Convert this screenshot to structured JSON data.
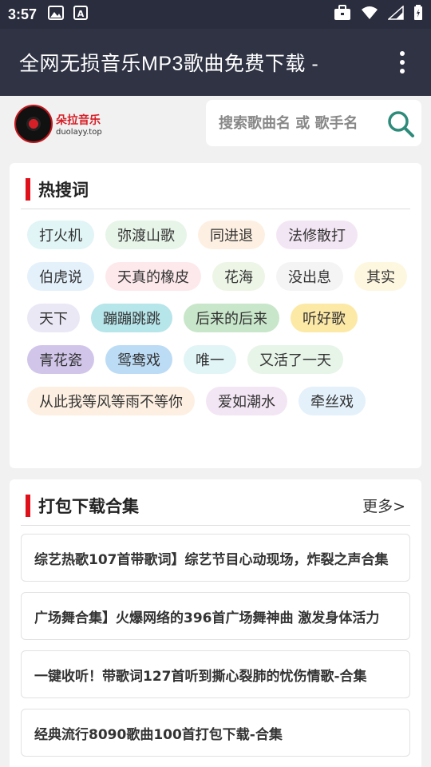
{
  "status": {
    "time": "3:57"
  },
  "app": {
    "title": "全网无损音乐MP3歌曲免费下载 -"
  },
  "logo": {
    "cn": "朵拉音乐",
    "en": "duolayy.top"
  },
  "search": {
    "placeholder": "搜索歌曲名 或 歌手名"
  },
  "hot": {
    "title": "热搜词",
    "tags": [
      {
        "label": "打火机",
        "color": "#e1f4f6"
      },
      {
        "label": "弥渡山歌",
        "color": "#e7f4e8"
      },
      {
        "label": "同进退",
        "color": "#fdf0e2"
      },
      {
        "label": "法修散打",
        "color": "#f3e6f4"
      },
      {
        "label": "伯虎说",
        "color": "#e4f1fb"
      },
      {
        "label": "天真的橡皮",
        "color": "#fde9ec"
      },
      {
        "label": "花海",
        "color": "#edf5e6"
      },
      {
        "label": "没出息",
        "color": "#f4f4f4"
      },
      {
        "label": "其实",
        "color": "#fdf7e0"
      },
      {
        "label": "天下",
        "color": "#ebe8f6"
      },
      {
        "label": "蹦蹦跳跳",
        "color": "#b6e5ea"
      },
      {
        "label": "后来的后来",
        "color": "#c8e6c9"
      },
      {
        "label": "听好歌",
        "color": "#fde9a6"
      },
      {
        "label": "青花瓷",
        "color": "#d1c6ea"
      },
      {
        "label": "鸳鸯戏",
        "color": "#bcdcf5"
      },
      {
        "label": "唯一",
        "color": "#e1f4f6"
      },
      {
        "label": "又活了一天",
        "color": "#e7f4e8"
      },
      {
        "label": "从此我等风等雨不等你",
        "color": "#fdf0e2"
      },
      {
        "label": "爱如潮水",
        "color": "#f3e6f4"
      },
      {
        "label": "牵丝戏",
        "color": "#e4f1fb"
      }
    ]
  },
  "pack": {
    "title": "打包下载合集",
    "more": "更多>",
    "items": [
      "综艺热歌107首带歌词】综艺节目心动现场，炸裂之声合集",
      "广场舞合集】火爆网络的396首广场舞神曲 激发身体活力",
      "一键收听！带歌词127首听到撕心裂肺的忧伤情歌-合集",
      "经典流行8090歌曲100首打包下载-合集"
    ]
  }
}
